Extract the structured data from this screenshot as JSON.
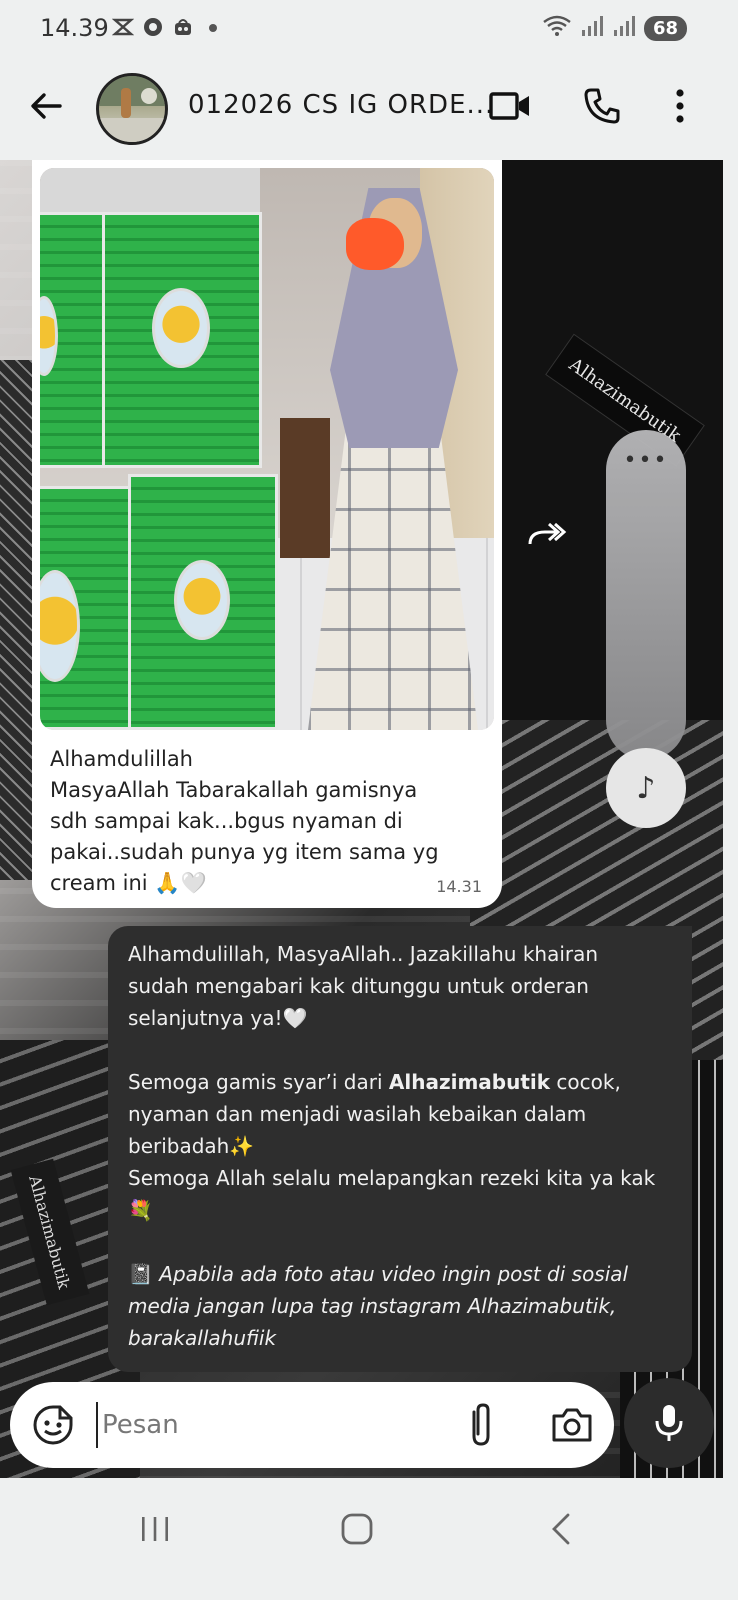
{
  "status_bar": {
    "time": "14.39",
    "battery": "68",
    "icons_left": [
      "sync-icon",
      "target-icon",
      "bag-icon",
      "dot-icon"
    ],
    "icons_right": [
      "wifi-icon",
      "signal-icon",
      "signal-icon"
    ]
  },
  "header": {
    "title": "012026 CS IG ORDE...",
    "icons": [
      "back-arrow-icon",
      "video-call-icon",
      "phone-icon",
      "more-vertical-icon"
    ]
  },
  "messages": [
    {
      "direction": "incoming",
      "has_photo": true,
      "lines": [
        "Alhamdulillah",
        "MasyaAllah Tabarakallah gamisnya",
        "sdh sampai kak...bgus nyaman di",
        "pakai..sudah punya yg item sama yg",
        "cream ini 🙏🤍"
      ],
      "time": "14.31"
    },
    {
      "direction": "outgoing",
      "lines": [
        "Alhamdulillah, MasyaAllah.. Jazakillahu khairan",
        "sudah mengabari kak ditunggu untuk orderan",
        "selanjutnya ya!🤍",
        "Semoga gamis syar’i dari ",
        "Alhazimabutik",
        " cocok,",
        "nyaman dan menjadi wasilah kebaikan dalam",
        "beribadah✨",
        "Semoga Allah selalu melapangkan rezeki kita ya kak",
        "💐",
        "📓",
        "Apabila ada foto atau video ingin post di sosial",
        "media jangan lupa tag instagram Alhazimabutik,",
        "barakallahufiik"
      ]
    }
  ],
  "wallpaper": {
    "label": "Alhazimabutik"
  },
  "side_widget": {
    "dots": "•••",
    "music": "♪",
    "forward": "»"
  },
  "input": {
    "placeholder": "Pesan",
    "icons": [
      "emoji-icon",
      "attach-icon",
      "camera-icon",
      "mic-icon"
    ]
  },
  "nav": {
    "recent": "III",
    "home": "○",
    "back": "‹"
  },
  "colors": {
    "incoming_bubble": "#ffffff",
    "outgoing_bubble": "#2e2e2e",
    "bar_bg": "#eef0f0"
  }
}
